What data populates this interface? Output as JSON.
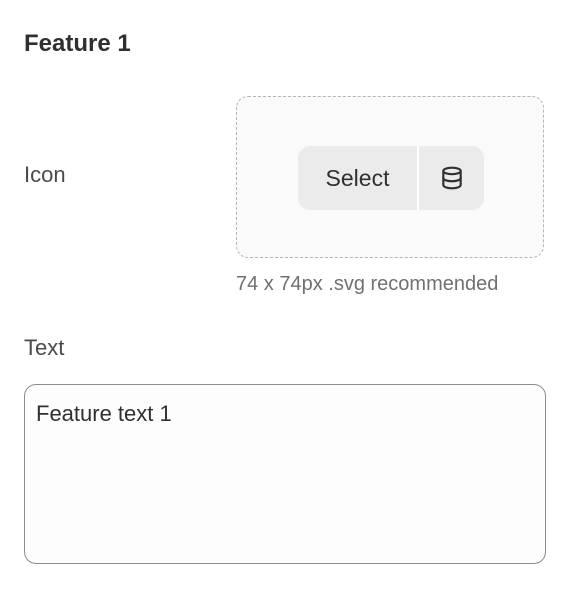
{
  "feature": {
    "title": "Feature 1",
    "icon_label": "Icon",
    "select_button": "Select",
    "db_icon": "database-icon",
    "helper_text": "74 x 74px .svg recommended",
    "text_label": "Text",
    "text_value": "Feature text 1"
  },
  "colors": {
    "text_primary": "#303030",
    "text_secondary": "#707070",
    "button_bg": "#ebebeb",
    "dropzone_border": "#b5b5b5",
    "input_border": "#8c8c8c"
  }
}
